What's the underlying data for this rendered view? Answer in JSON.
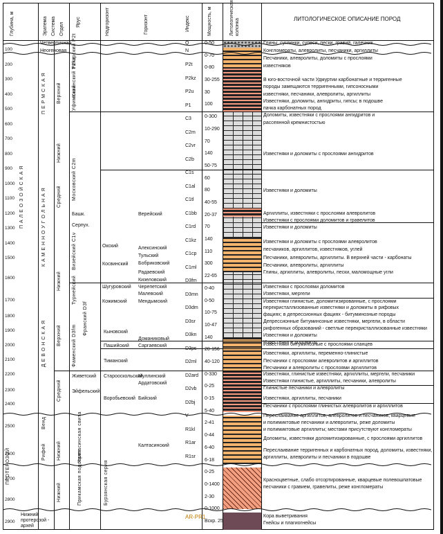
{
  "header": {
    "depth": "Глубина, м",
    "system_group": "Эратема",
    "system": "Система",
    "series": "Отдел",
    "stage": "Ярус",
    "superhorizon": "Надгоризонт",
    "horizon": "Горизонт",
    "index": "Индекс",
    "thickness": "Мощность, м",
    "column": "Литологическая колонка",
    "description": "ЛИТОЛОГИЧЕСКОЕ ОПИСАНИЕ ПОРОД"
  },
  "depths": [
    "100",
    "200",
    "300",
    "400",
    "500",
    "600",
    "700",
    "800",
    "900",
    "1000",
    "1100",
    "1200",
    "1300",
    "1400",
    "1500",
    "1600",
    "1700",
    "1800",
    "1900",
    "2000",
    "2100",
    "2200",
    "2300",
    "2400",
    "2500",
    "2600",
    "2700",
    "2800",
    "2900"
  ],
  "eras": {
    "paleozoic": "П А Л Е О З О Й С К А Я",
    "proterozoic": "ПРОТЕРОЗОЙ",
    "archean": "Нижний протерозой - архей"
  },
  "systems": {
    "quaternary": "Четвертичная",
    "neogene": "Неогеновая",
    "permian": "П Е Р М С К А Я",
    "carboniferous": "К А М Е Н Н О У Г О Л Ь Н А Я",
    "devonian": "Д Е В О Н С К А Я",
    "vendian": "Венд",
    "riphean": "Рифей"
  },
  "series": {
    "p_upper": "Верхний",
    "p_lower": "Нижний",
    "c_upper": "Верхний",
    "c_middle": "Средний",
    "c_lower": "Нижний",
    "d_upper": "Верхний",
    "d_middle": "Средний",
    "r_lower": "Нижний",
    "r_lower2": "Нижний"
  },
  "stages": {
    "tatar": "Татарский P2t",
    "kazan": "Казанский P2kz",
    "ufa": "Уфимский",
    "moscow": "Московский C2m",
    "bashk": "Башк.",
    "serp": "Серпух.",
    "vise": "Визейский C1v",
    "tourn": "Турнейский",
    "famen": "Фаменский D3fm",
    "fran": "Франский D3f",
    "givet": "Живетский",
    "eifel": "Эйфельский",
    "kaltas": "Калтасинская свита",
    "burzyan": "Бурзянская серия",
    "prikam": "Прикамская подсерия"
  },
  "superhorizons": {
    "okskiy": "Окский",
    "kizel": "Кожимский",
    "kosvin": "Косвинский",
    "shchigrov": "Шугуровский",
    "kyn": "Кыновский",
    "pashiy": "Пашийский",
    "timan": "Тиманский",
    "starooskol": "Старооскольский",
    "vorobiev": "Воробьевский"
  },
  "horizons": {
    "vereisk": "Верейский",
    "aleksin": "Алексинский",
    "tula": "Тульский",
    "bobrikov": "Бобриковский",
    "radaev": "Радаевский",
    "kizel": "Кизеловский",
    "cherepet": "Черепетский",
    "malev": "Малевский",
    "mendym": "Мендымский",
    "domanik": "Доманиковый",
    "sargaev": "Саргаевский",
    "mullin": "Муллинский",
    "ardatov": "Ардатовский",
    "bilyaz": "Бийский",
    "kaltas": "Калтасинский"
  },
  "indices": [
    "Q",
    "N",
    "P2t",
    "P2kz",
    "P2u",
    "P1",
    "C3",
    "C2m",
    "C2vr",
    "C2b",
    "C1s",
    "C1al",
    "C1tl",
    "C1bb",
    "C1rd",
    "C1kz",
    "C1cp",
    "C1ml",
    "D3fm",
    "D3mn",
    "D3dm",
    "D3sr",
    "D3kn",
    "D3ps",
    "D2ml",
    "D2ard",
    "D2vb",
    "D2bj",
    "V",
    "R1kl",
    "R1ar",
    "R1sr",
    "AR-PR1"
  ],
  "thickness": [
    "0-50",
    "0-70",
    "0-80",
    "30-255",
    "30",
    "100",
    "0-300",
    "10-290",
    "70",
    "140",
    "50-75",
    "60",
    "80",
    "40-55",
    "20-37",
    "70",
    "140",
    "110",
    "300",
    "22-65",
    "0-40",
    "0-50",
    "10-75",
    "10-47",
    "140",
    "20-156",
    "40-120",
    "0-330",
    "0-25",
    "0-15",
    "5-40",
    "2-41",
    "0-44",
    "6-40",
    "6-18",
    "0-25",
    "0-1400",
    "2-30",
    "0-1000",
    "Вскр. 25"
  ],
  "descriptions": [
    "Глины, суглинки, супеси, пески, гравий, галечник",
    "Конгломераты, алевролиты, песчаники, аргиллиты",
    "Песчаники, алевролиты, доломиты с прослоями",
    "известняков",
    "В юго-восточной части Удмуртии карбонатные и терригенные",
    "породы замещаются терригенными, гипсоносными",
    "известняки, песчаники, алевролиты, аргиллиты",
    "Известняки, доломиты, ангидриты, гипсы; в подошве",
    "пачка карбонатных пород",
    "Доломиты, известняки с прослоями ангидритов и",
    "рассеянной кремнистостью",
    "Известняки и доломиты с прослоями ангидритов",
    "Известняки и доломиты",
    "Аргиллиты, известняки с прослоями алевролитов",
    "Известняки с прослоями доломитов и гравелитов",
    "Известняки и доломиты",
    "Известняки и доломиты с прослоями алевролитов",
    "песчаников, аргиллитов, известняков, углей",
    "Песчаники, алевролиты, аргиллиты. В верхней части - карбонаты",
    "Песчаники, алевролиты, аргиллиты",
    "Глины, аргиллиты, алевролиты, пески, маломощные угли",
    "Известняки с прослоями доломитов",
    "Известняки, мергели",
    "Известняки глинистые, доломитизированные, с прослоями",
    "перекристаллизованные известняки и доломиты в рифовых",
    "фациях; в депрессионных фациях - битуминозные породы",
    "Депрессионные битуминозные известняки, мергели, в области",
    "рифогенных образований - светлые перекристаллизованные известняки",
    "Известняки и доломиты",
    "Известняки и доломиты",
    "Известняки битуминозные с прослоями сланцев",
    "Известняки, аргиллиты, переменно-глинистые",
    "Песчаники с прослоями алевролитов и аргиллитов",
    "Песчаники и алевролиты с прослоями аргиллитов",
    "Известняки, глинистые известняки, аргиллиты, мергели, песчаники",
    "Известняки глинистые, аргиллиты, песчаники, алевролиты",
    "Глинистые песчаники и алевролиты",
    "Известняки, аргиллиты, песчаники",
    "Песчаники с прослоями глинистых алевролитов и аргиллитов",
    "Переслаивание аргиллитов, алевролитов и песчаников, кварцевые",
    "и полимиктовые песчаники и алевролиты, реже доломиты",
    "и полимиктовые аргиллиты; местами присутствуют конгломераты",
    "Доломиты, известняки доломитизированные, с прослоями аргиллитов",
    "Переслаивание терригенных и карбонатных пород, доломиты, известняки,",
    "аргиллиты, алевролиты и песчаники в подошве",
    "Красноцветные, слабо отсортированные, кварцевые полевошпатовые",
    "песчаники с гравием, гравелиты, реже конгломераты",
    "Кора выветривания",
    "Гнейсы и плагиогнейсы"
  ],
  "colors": {
    "limestone": "#dddddd",
    "sandstone": "#f3b36d",
    "clay": "#222222",
    "red_beds": "#f4a080",
    "basement": "#6e4a56",
    "index_accent": "#c07a00"
  }
}
